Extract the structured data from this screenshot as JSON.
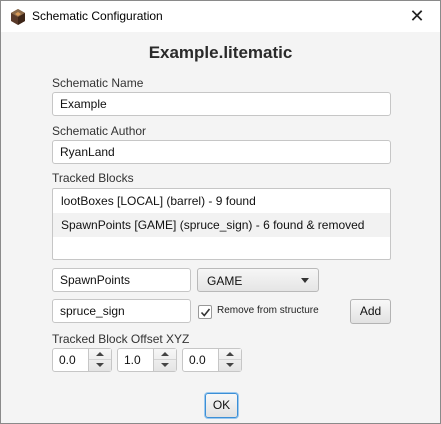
{
  "window": {
    "title": "Schematic Configuration",
    "close_symbol": "✕",
    "icon": "minecraft-block-icon"
  },
  "heading": "Example.litematic",
  "name_field": {
    "label": "Schematic Name",
    "value": "Example"
  },
  "author_field": {
    "label": "Schematic Author",
    "value": "RyanLand"
  },
  "tracked_blocks": {
    "label": "Tracked Blocks",
    "items": [
      "lootBoxes [LOCAL] (barrel) - 9 found",
      "SpawnPoints [GAME] (spruce_sign) - 6 found & removed"
    ]
  },
  "block_name_input": "SpawnPoints",
  "scope_select": {
    "value": "GAME"
  },
  "block_type_input": "spruce_sign",
  "remove_checkbox": {
    "checked": true,
    "label": "Remove from structure"
  },
  "add_button": "Add",
  "offset": {
    "label": "Tracked Block Offset XYZ",
    "x": "0.0",
    "y": "1.0",
    "z": "0.0"
  },
  "ok_button": "OK"
}
